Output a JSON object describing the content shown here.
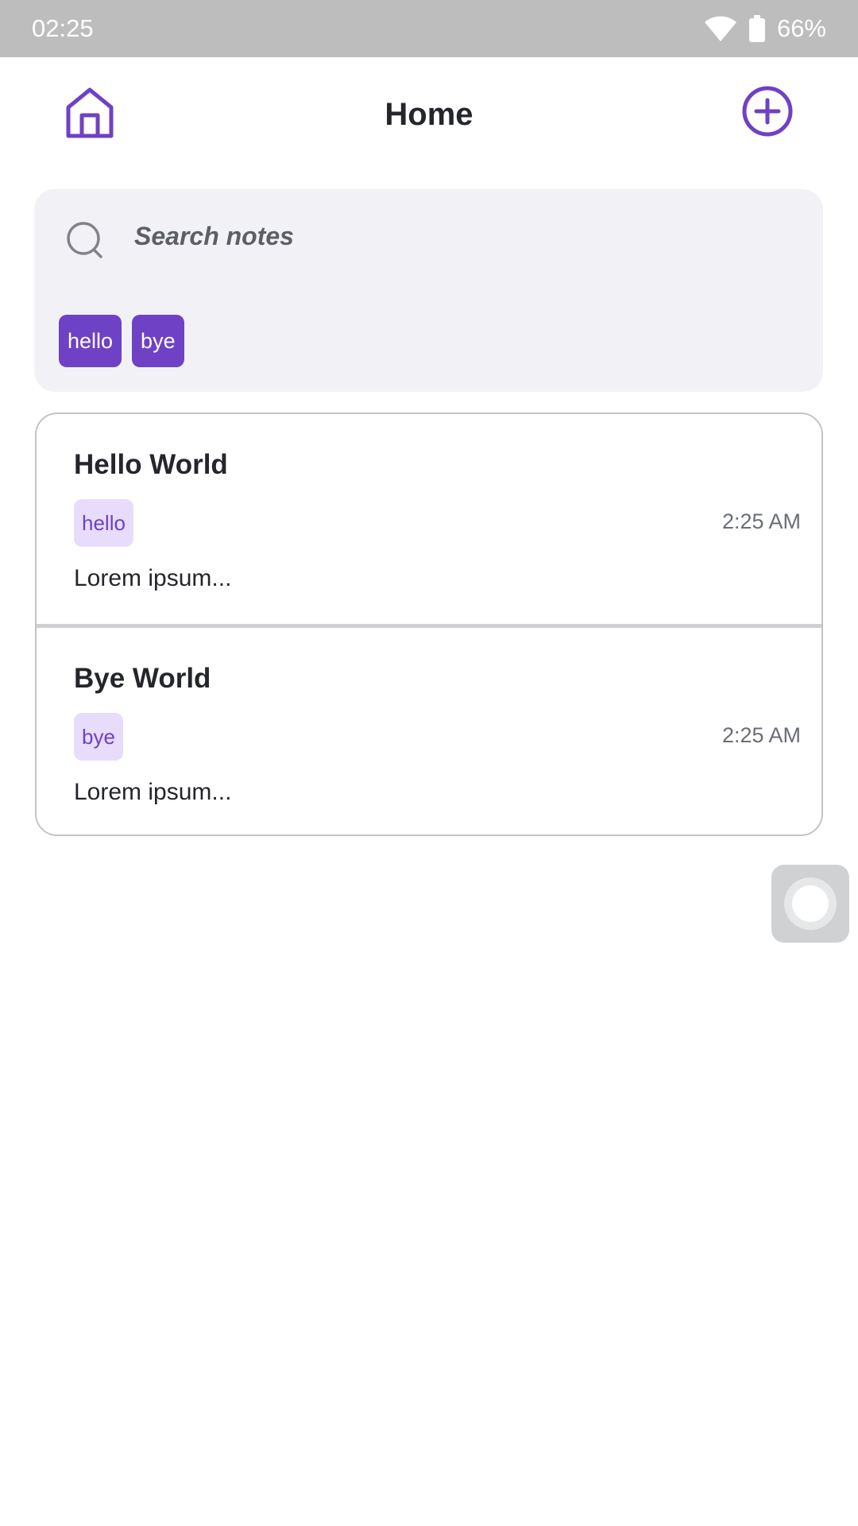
{
  "status_bar": {
    "time": "02:25",
    "battery": "66%",
    "icons": [
      "wifi-icon",
      "battery-icon"
    ]
  },
  "header": {
    "title": "Home",
    "left_icon": "home-icon",
    "right_icon": "plus-circle-icon"
  },
  "search": {
    "placeholder": "Search notes",
    "value": "",
    "icon": "search-icon",
    "filter_tags": [
      "hello",
      "bye"
    ]
  },
  "notes": [
    {
      "title": "Hello World",
      "tag": "hello",
      "time": "2:25 AM",
      "preview": "Lorem ipsum..."
    },
    {
      "title": "Bye World",
      "tag": "bye",
      "time": "2:25 AM",
      "preview": "Lorem ipsum..."
    }
  ],
  "colors": {
    "accent": "#6f41c4",
    "tag_background": "#e8dcfb",
    "status_bar": "#bdbdbd",
    "search_background": "#f2f2f6"
  },
  "floating_button": {
    "icon": "assistive-touch-icon"
  }
}
